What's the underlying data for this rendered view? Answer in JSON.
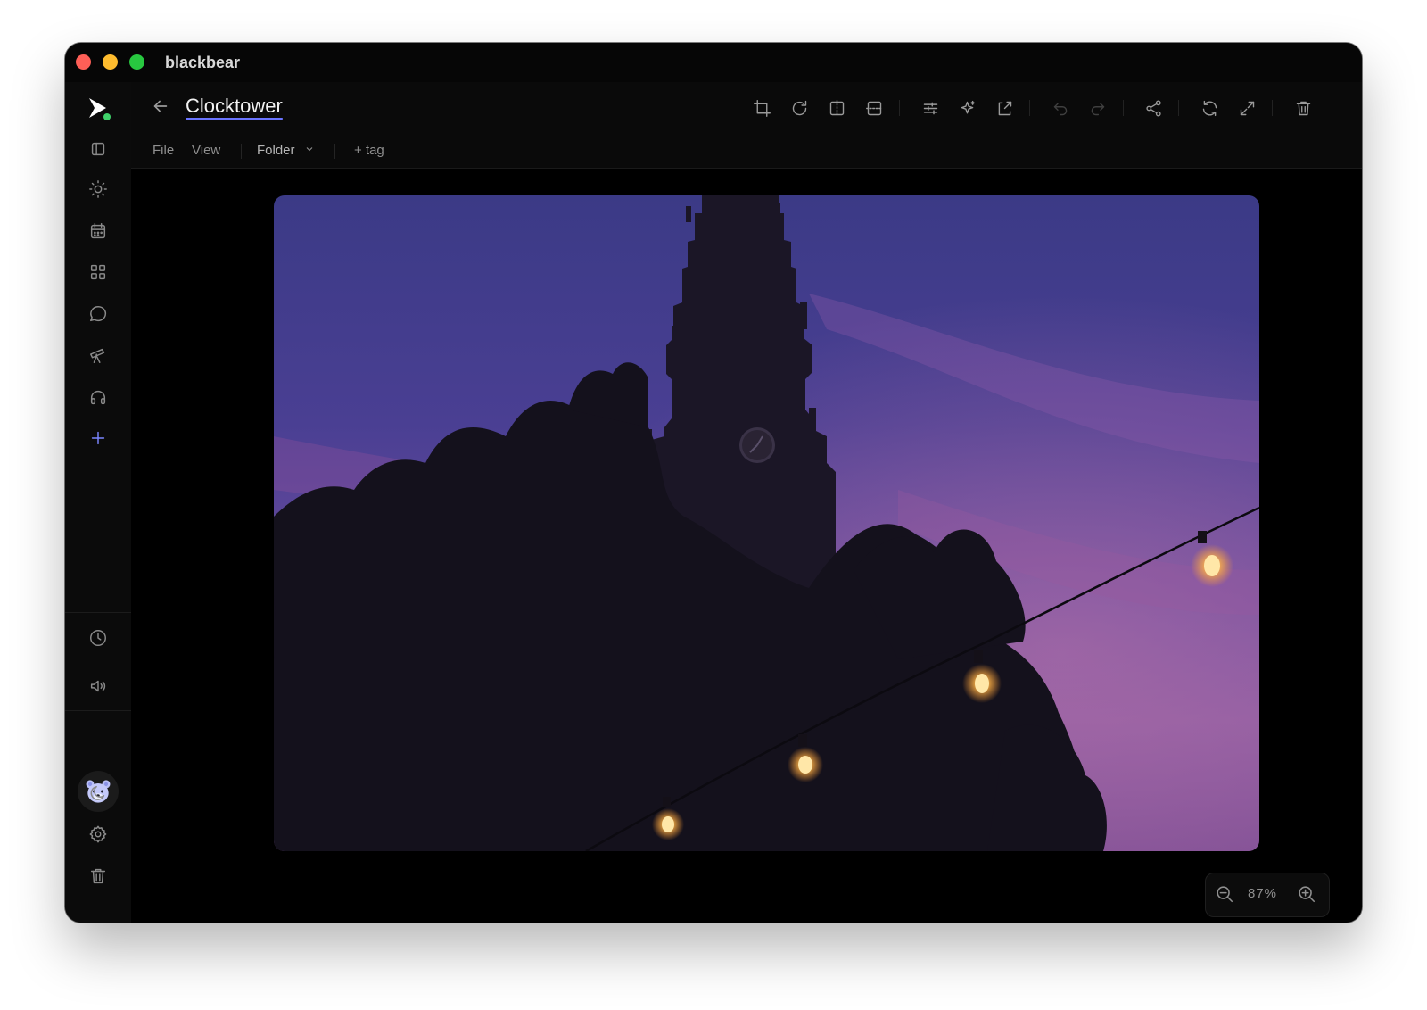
{
  "window": {
    "app_name": "blackbear"
  },
  "sidebar": {
    "top_items": [
      {
        "icon": "sidebar-toggle-icon"
      },
      {
        "icon": "sun-icon"
      },
      {
        "icon": "calendar-icon"
      },
      {
        "icon": "grid-icon"
      },
      {
        "icon": "chat-bubble-icon"
      },
      {
        "icon": "telescope-icon"
      },
      {
        "icon": "headphones-icon"
      },
      {
        "icon": "plus-icon"
      }
    ],
    "bottom_items": [
      {
        "icon": "clock-icon"
      },
      {
        "icon": "speaker-icon"
      },
      {
        "icon": "bear-avatar-icon"
      },
      {
        "icon": "moon-icon"
      },
      {
        "icon": "gear-icon"
      },
      {
        "icon": "trash-icon"
      }
    ]
  },
  "header": {
    "title": "Clocktower",
    "tools": [
      "crop-icon",
      "rotate-icon",
      "flip-horizontal-icon",
      "flip-vertical-icon",
      "adjustments-icon",
      "sparkle-icon",
      "export-icon",
      "undo-icon",
      "redo-icon",
      "share-icon",
      "refresh-icon",
      "fullscreen-icon",
      "trash-icon"
    ]
  },
  "menubar": {
    "file": "File",
    "view": "View",
    "folder": "Folder",
    "tag": "+ tag"
  },
  "viewer": {
    "zoom": "87%",
    "accent": "#6a74ff"
  }
}
